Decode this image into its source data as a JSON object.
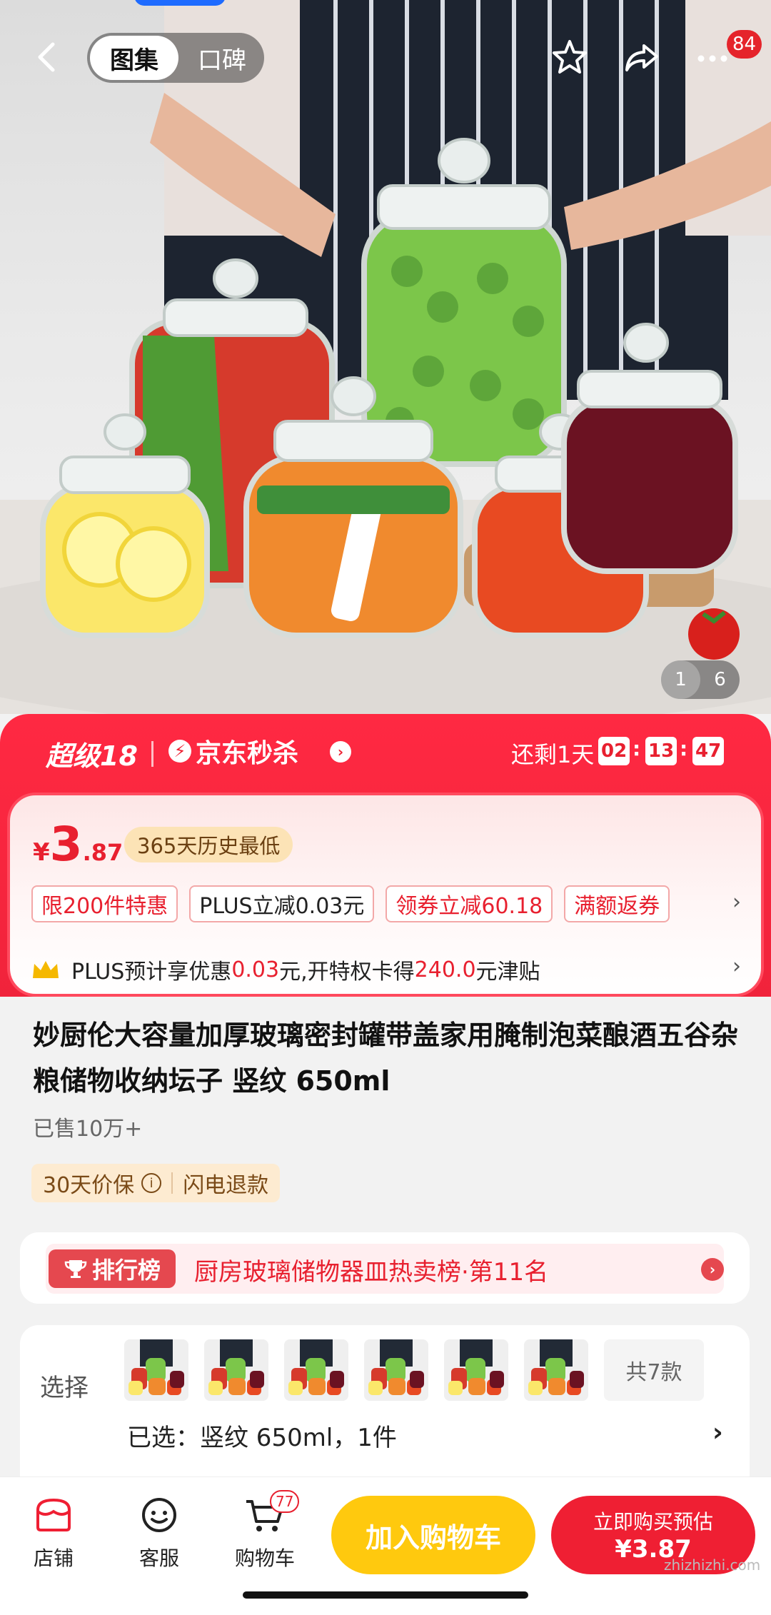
{
  "topbar": {
    "tab_active": "图集",
    "tab_inactive": "口碑",
    "message_count": "84"
  },
  "gallery": {
    "current": "1",
    "total": "6"
  },
  "promo": {
    "brand": "超级18",
    "flash_title": "京东秒杀",
    "remaining_label": "还剩1天",
    "countdown": {
      "h": "02",
      "m": "13",
      "s": "47"
    },
    "price_symbol": "¥",
    "price_int": "3",
    "price_dec": ".87",
    "lowest_badge": "365天历史最低",
    "tags": [
      {
        "text": "限200件特惠"
      },
      {
        "text": "PLUS立减0.03元"
      },
      {
        "text": "领券立减60.18"
      },
      {
        "text": "满额返券"
      }
    ],
    "plus_prefix": "PLUS预计享优惠",
    "plus_amount1": "0.03",
    "plus_mid": "元,开特权卡得",
    "plus_amount2": "240.0",
    "plus_suffix": "元津贴"
  },
  "product": {
    "title": "妙厨伦大容量加厚玻璃密封罐带盖家用腌制泡菜酿酒五谷杂粮储物收纳坛子 竖纹 650ml",
    "sold": "已售10万+",
    "guarantee1": "30天价保",
    "guarantee2": "闪电退款"
  },
  "ranking": {
    "tag": "排行榜",
    "text": "厨房玻璃储物器皿热卖榜·第11名"
  },
  "selection": {
    "label": "选择",
    "more": "共7款",
    "selected": "已选：竖纹 650ml，1件"
  },
  "bottom": {
    "store": "店铺",
    "service": "客服",
    "cart": "购物车",
    "cart_count": "77",
    "add_to_cart": "加入购物车",
    "buy_line1": "立即购买预估",
    "buy_line2": "¥3.87"
  },
  "watermark": "zhizhizhi.com",
  "colors": {
    "primary_red": "#ef1f33",
    "yellow": "#ffc90e",
    "badge_gold": "#fce3b6"
  }
}
